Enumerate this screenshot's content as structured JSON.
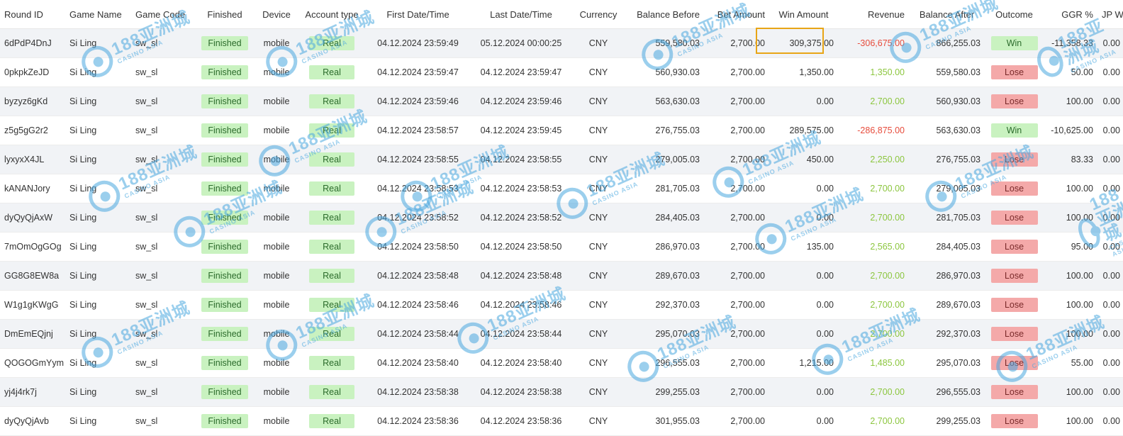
{
  "columns": [
    "Round ID",
    "Game Name",
    "Game Code",
    "Finished",
    "Device",
    "Account type",
    "First Date/Time",
    "Last Date/Time",
    "Currency",
    "Balance Before",
    "Bet Amount",
    "Win Amount",
    "Revenue",
    "Balance After",
    "Outcome",
    "GGR %",
    "JP Win"
  ],
  "watermark": {
    "logo": "CQ9",
    "big": "188亚洲城",
    "small": "CASINO ASIA"
  },
  "colors": {
    "finished_bg": "#c9f2c0",
    "win_bg": "#c9f2c0",
    "lose_bg": "#f4a9a9",
    "revenue_positive": "#8cc63f",
    "revenue_negative": "#e74c3c",
    "highlight": "#e8a516"
  },
  "rows": [
    {
      "round_id": "6dPdP4DnJ",
      "game_name": "Si Ling",
      "game_code": "sw_sl",
      "finished": "Finished",
      "device": "mobile",
      "account_type": "Real",
      "first": "04.12.2024 23:59:49",
      "last": "05.12.2024 00:00:25",
      "currency": "CNY",
      "balance_before": "559,580.03",
      "bet": "2,700.00",
      "win": "309,375.00",
      "revenue": "-306,675.00",
      "balance_after": "866,255.03",
      "outcome": "Win",
      "ggr": "-11,358.33",
      "jp": "0.00"
    },
    {
      "round_id": "0pkpkZeJD",
      "game_name": "Si Ling",
      "game_code": "sw_sl",
      "finished": "Finished",
      "device": "mobile",
      "account_type": "Real",
      "first": "04.12.2024 23:59:47",
      "last": "04.12.2024 23:59:47",
      "currency": "CNY",
      "balance_before": "560,930.03",
      "bet": "2,700.00",
      "win": "1,350.00",
      "revenue": "1,350.00",
      "balance_after": "559,580.03",
      "outcome": "Lose",
      "ggr": "50.00",
      "jp": "0.00"
    },
    {
      "round_id": "byzyz6gKd",
      "game_name": "Si Ling",
      "game_code": "sw_sl",
      "finished": "Finished",
      "device": "mobile",
      "account_type": "Real",
      "first": "04.12.2024 23:59:46",
      "last": "04.12.2024 23:59:46",
      "currency": "CNY",
      "balance_before": "563,630.03",
      "bet": "2,700.00",
      "win": "0.00",
      "revenue": "2,700.00",
      "balance_after": "560,930.03",
      "outcome": "Lose",
      "ggr": "100.00",
      "jp": "0.00"
    },
    {
      "round_id": "z5g5gG2r2",
      "game_name": "Si Ling",
      "game_code": "sw_sl",
      "finished": "Finished",
      "device": "mobile",
      "account_type": "Real",
      "first": "04.12.2024 23:58:57",
      "last": "04.12.2024 23:59:45",
      "currency": "CNY",
      "balance_before": "276,755.03",
      "bet": "2,700.00",
      "win": "289,575.00",
      "revenue": "-286,875.00",
      "balance_after": "563,630.03",
      "outcome": "Win",
      "ggr": "-10,625.00",
      "jp": "0.00"
    },
    {
      "round_id": "lyxyxX4JL",
      "game_name": "Si Ling",
      "game_code": "sw_sl",
      "finished": "Finished",
      "device": "mobile",
      "account_type": "Real",
      "first": "04.12.2024 23:58:55",
      "last": "04.12.2024 23:58:55",
      "currency": "CNY",
      "balance_before": "279,005.03",
      "bet": "2,700.00",
      "win": "450.00",
      "revenue": "2,250.00",
      "balance_after": "276,755.03",
      "outcome": "Lose",
      "ggr": "83.33",
      "jp": "0.00"
    },
    {
      "round_id": "kANANJory",
      "game_name": "Si Ling",
      "game_code": "sw_sl",
      "finished": "Finished",
      "device": "mobile",
      "account_type": "Real",
      "first": "04.12.2024 23:58:53",
      "last": "04.12.2024 23:58:53",
      "currency": "CNY",
      "balance_before": "281,705.03",
      "bet": "2,700.00",
      "win": "0.00",
      "revenue": "2,700.00",
      "balance_after": "279,005.03",
      "outcome": "Lose",
      "ggr": "100.00",
      "jp": "0.00"
    },
    {
      "round_id": "dyQyQjAxW",
      "game_name": "Si Ling",
      "game_code": "sw_sl",
      "finished": "Finished",
      "device": "mobile",
      "account_type": "Real",
      "first": "04.12.2024 23:58:52",
      "last": "04.12.2024 23:58:52",
      "currency": "CNY",
      "balance_before": "284,405.03",
      "bet": "2,700.00",
      "win": "0.00",
      "revenue": "2,700.00",
      "balance_after": "281,705.03",
      "outcome": "Lose",
      "ggr": "100.00",
      "jp": "0.00"
    },
    {
      "round_id": "7mOmOgGOg",
      "game_name": "Si Ling",
      "game_code": "sw_sl",
      "finished": "Finished",
      "device": "mobile",
      "account_type": "Real",
      "first": "04.12.2024 23:58:50",
      "last": "04.12.2024 23:58:50",
      "currency": "CNY",
      "balance_before": "286,970.03",
      "bet": "2,700.00",
      "win": "135.00",
      "revenue": "2,565.00",
      "balance_after": "284,405.03",
      "outcome": "Lose",
      "ggr": "95.00",
      "jp": "0.00"
    },
    {
      "round_id": "GG8G8EW8a",
      "game_name": "Si Ling",
      "game_code": "sw_sl",
      "finished": "Finished",
      "device": "mobile",
      "account_type": "Real",
      "first": "04.12.2024 23:58:48",
      "last": "04.12.2024 23:58:48",
      "currency": "CNY",
      "balance_before": "289,670.03",
      "bet": "2,700.00",
      "win": "0.00",
      "revenue": "2,700.00",
      "balance_after": "286,970.03",
      "outcome": "Lose",
      "ggr": "100.00",
      "jp": "0.00"
    },
    {
      "round_id": "W1g1gKWgG",
      "game_name": "Si Ling",
      "game_code": "sw_sl",
      "finished": "Finished",
      "device": "mobile",
      "account_type": "Real",
      "first": "04.12.2024 23:58:46",
      "last": "04.12.2024 23:58:46",
      "currency": "CNY",
      "balance_before": "292,370.03",
      "bet": "2,700.00",
      "win": "0.00",
      "revenue": "2,700.00",
      "balance_after": "289,670.03",
      "outcome": "Lose",
      "ggr": "100.00",
      "jp": "0.00"
    },
    {
      "round_id": "DmEmEQjnj",
      "game_name": "Si Ling",
      "game_code": "sw_sl",
      "finished": "Finished",
      "device": "mobile",
      "account_type": "Real",
      "first": "04.12.2024 23:58:44",
      "last": "04.12.2024 23:58:44",
      "currency": "CNY",
      "balance_before": "295,070.03",
      "bet": "2,700.00",
      "win": "0.00",
      "revenue": "2,700.00",
      "balance_after": "292,370.03",
      "outcome": "Lose",
      "ggr": "100.00",
      "jp": "0.00"
    },
    {
      "round_id": "QOGOGmYym",
      "game_name": "Si Ling",
      "game_code": "sw_sl",
      "finished": "Finished",
      "device": "mobile",
      "account_type": "Real",
      "first": "04.12.2024 23:58:40",
      "last": "04.12.2024 23:58:40",
      "currency": "CNY",
      "balance_before": "296,555.03",
      "bet": "2,700.00",
      "win": "1,215.00",
      "revenue": "1,485.00",
      "balance_after": "295,070.03",
      "outcome": "Lose",
      "ggr": "55.00",
      "jp": "0.00"
    },
    {
      "round_id": "yj4j4rk7j",
      "game_name": "Si Ling",
      "game_code": "sw_sl",
      "finished": "Finished",
      "device": "mobile",
      "account_type": "Real",
      "first": "04.12.2024 23:58:38",
      "last": "04.12.2024 23:58:38",
      "currency": "CNY",
      "balance_before": "299,255.03",
      "bet": "2,700.00",
      "win": "0.00",
      "revenue": "2,700.00",
      "balance_after": "296,555.03",
      "outcome": "Lose",
      "ggr": "100.00",
      "jp": "0.00"
    },
    {
      "round_id": "dyQyQjAvb",
      "game_name": "Si Ling",
      "game_code": "sw_sl",
      "finished": "Finished",
      "device": "mobile",
      "account_type": "Real",
      "first": "04.12.2024 23:58:36",
      "last": "04.12.2024 23:58:36",
      "currency": "CNY",
      "balance_before": "301,955.03",
      "bet": "2,700.00",
      "win": "0.00",
      "revenue": "2,700.00",
      "balance_after": "299,255.03",
      "outcome": "Lose",
      "ggr": "100.00",
      "jp": "0.00"
    }
  ]
}
